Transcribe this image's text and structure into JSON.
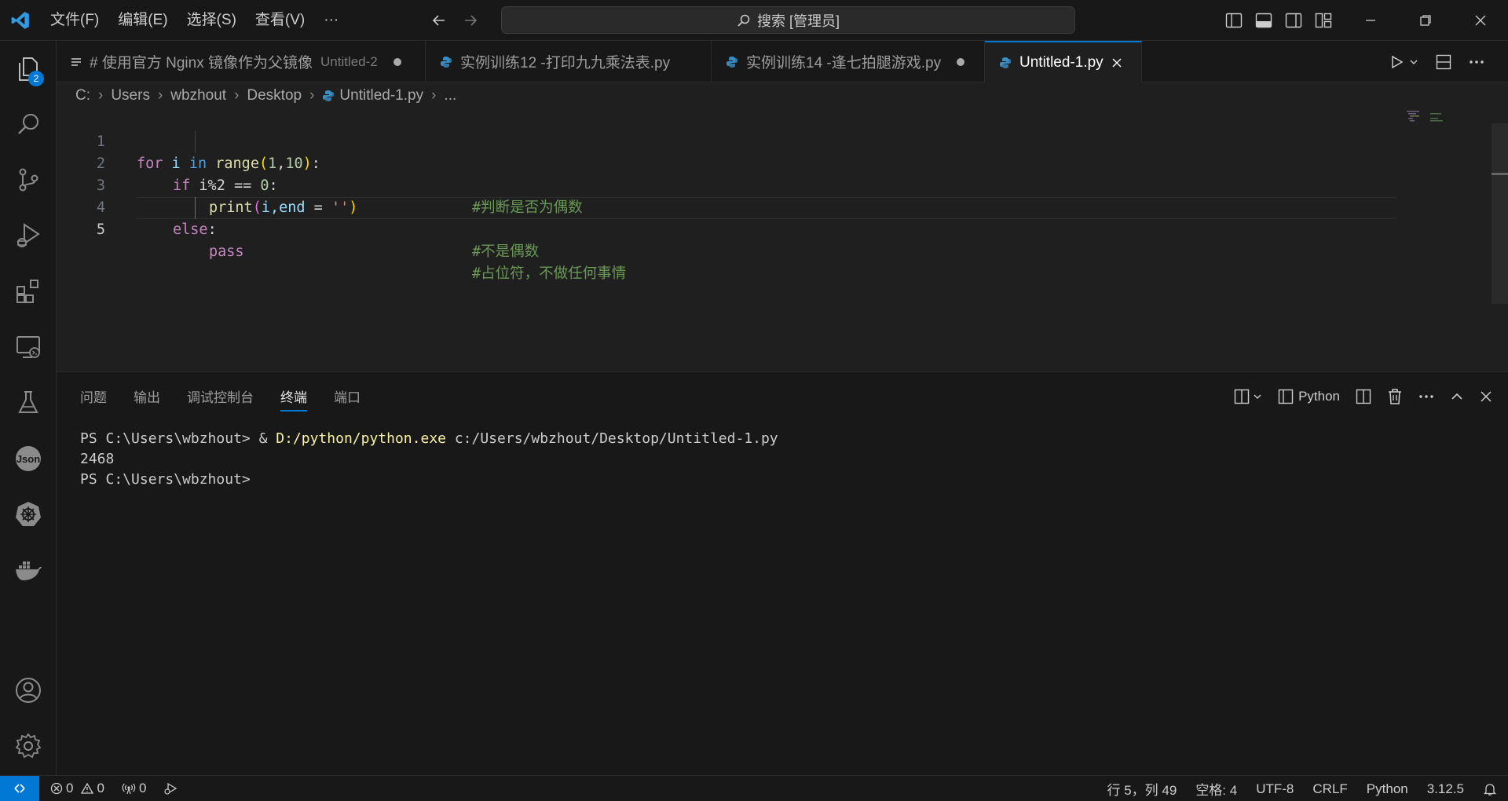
{
  "menu": {
    "items": [
      "文件(F)",
      "编辑(E)",
      "选择(S)",
      "查看(V)",
      "···"
    ]
  },
  "search": {
    "label": "搜索 [管理员]"
  },
  "activity": {
    "explorer_badge": "2"
  },
  "tabs": [
    {
      "label": "# 使用官方 Nginx 镜像作为父镜像",
      "desc": "Untitled-2"
    },
    {
      "label": "实例训练12 -打印九九乘法表.py"
    },
    {
      "label": "实例训练14 -逢七拍腿游戏.py"
    },
    {
      "label": "Untitled-1.py"
    }
  ],
  "breadcrumb": [
    "C:",
    "Users",
    "wbzhout",
    "Desktop",
    "Untitled-1.py",
    "..."
  ],
  "editor": {
    "line_numbers": [
      "1",
      "2",
      "3",
      "4",
      "5"
    ],
    "line1": {
      "kw_for": "for",
      "var_i": " i ",
      "kw_in": "in",
      "fn_range": " range",
      "p_open": "(",
      "n1": "1",
      "comma": ",",
      "n2": "10",
      "p_close": ")",
      "colon": ":"
    },
    "line2": {
      "kw_if": "if",
      "expr": " i%2 == ",
      "n0": "0",
      "colon": ":",
      "comment": "#判断是否为偶数"
    },
    "line3": {
      "fn_print": "print",
      "p_open": "(",
      "arg_i": "i,",
      "kwarg": "end",
      "eq": " = ",
      "str": "''",
      "p_close": ")"
    },
    "line4": {
      "kw_else": "else",
      "colon": ":",
      "comment": "#不是偶数"
    },
    "line5": {
      "kw_pass": "pass",
      "comment": "#占位符，不做任何事情"
    }
  },
  "panel": {
    "tabs": [
      "问题",
      "输出",
      "调试控制台",
      "终端",
      "端口"
    ],
    "active_tab": "终端",
    "terminal_profile": "Python",
    "terminal": {
      "line1_prompt": "PS C:\\Users\\wbzhout> & ",
      "line1_exe": "D:/python/python.exe",
      "line1_arg": " c:/Users/wbzhout/Desktop/Untitled-1.py",
      "line2": "2468",
      "line3": "PS C:\\Users\\wbzhout>"
    }
  },
  "status": {
    "errors": "0",
    "warnings": "0",
    "ports": "0",
    "position": "行 5，列 49",
    "spaces": "空格: 4",
    "encoding": "UTF-8",
    "eol": "CRLF",
    "language": "Python",
    "version": "3.12.5"
  },
  "colors": {
    "accent": "#0078d4",
    "background": "#1f1f1f",
    "sidebar": "#181818"
  }
}
